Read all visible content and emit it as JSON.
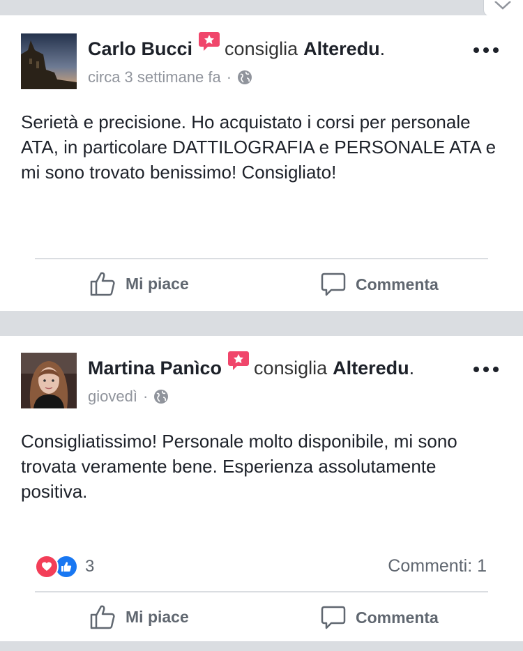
{
  "posts": [
    {
      "author": "Carlo Bucci",
      "verb": "consiglia",
      "page": "Alteredu",
      "time": "circa 3 settimane fa",
      "body": "Serietà e precisione. Ho acquistato i corsi per personale ATA, in particolare DATTILOGRAFIA e PERSONALE ATA e mi sono trovato benissimo! Consigliato!",
      "like_label": "Mi piace",
      "comment_label": "Commenta"
    },
    {
      "author": "Martina Panìco",
      "verb": "consiglia",
      "page": "Alteredu",
      "time": "giovedì",
      "body": "Consigliatissimo! Personale molto disponibile, mi sono trovata veramente bene. Esperienza assolutamente positiva.",
      "reaction_count": "3",
      "comments_count": "Commenti: 1",
      "like_label": "Mi piace",
      "comment_label": "Commenta"
    }
  ],
  "separator": "·",
  "period": ".",
  "colors": {
    "recommend": "#f0466b",
    "love": "#f33e58",
    "like": "#1877f2",
    "text": "#1d2129",
    "meta": "#90949c"
  },
  "icons": [
    "close-icon",
    "recommend-icon",
    "globe-icon",
    "more-options-icon",
    "like-thumb-icon",
    "comment-icon",
    "love-reaction-icon",
    "like-reaction-icon"
  ]
}
